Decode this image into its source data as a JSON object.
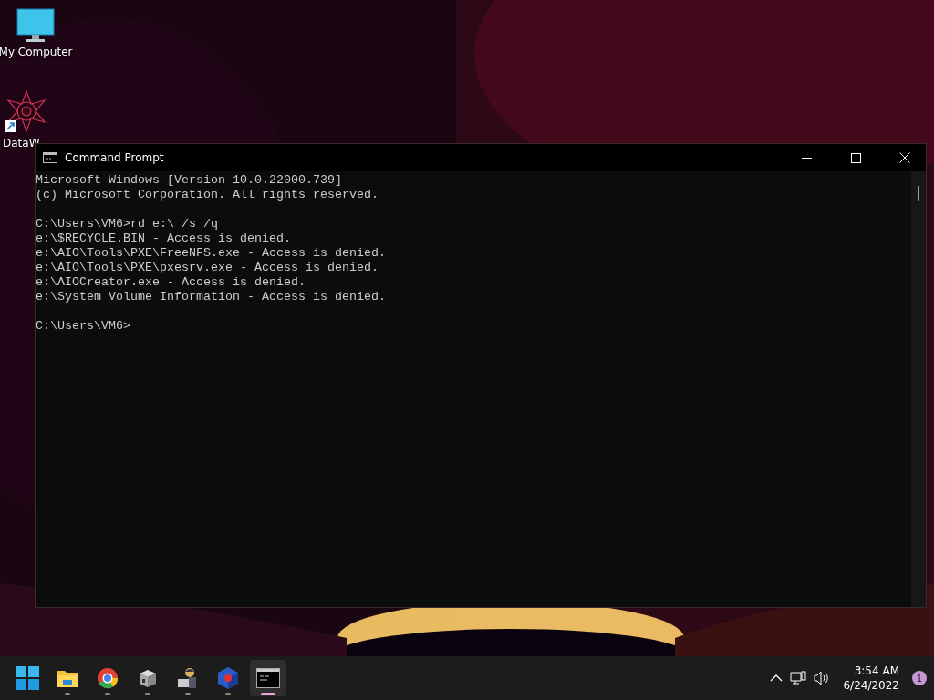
{
  "desktop_icons": [
    {
      "kind": "monitor",
      "label": "My Computer"
    },
    {
      "kind": "shortcut",
      "label": "DataW"
    }
  ],
  "window": {
    "title": "Command Prompt",
    "blocks": [
      [
        "Microsoft Windows [Version 10.0.22000.739]",
        "(c) Microsoft Corporation. All rights reserved."
      ],
      [
        "C:\\Users\\VM6>rd e:\\ /s /q",
        "e:\\$RECYCLE.BIN - Access is denied.",
        "e:\\AIO\\Tools\\PXE\\FreeNFS.exe - Access is denied.",
        "e:\\AIO\\Tools\\PXE\\pxesrv.exe - Access is denied.",
        "e:\\AIOCreator.exe - Access is denied.",
        "e:\\System Volume Information - Access is denied."
      ],
      [
        "C:\\Users\\VM6>"
      ]
    ]
  },
  "taskbar": {
    "apps": [
      {
        "kind": "start",
        "open": false,
        "selected": false
      },
      {
        "kind": "folder",
        "open": true,
        "selected": false
      },
      {
        "kind": "browser",
        "open": true,
        "selected": false
      },
      {
        "kind": "box",
        "open": true,
        "selected": false
      },
      {
        "kind": "figure",
        "open": true,
        "selected": false
      },
      {
        "kind": "cube",
        "open": true,
        "selected": false
      },
      {
        "kind": "terminal",
        "open": true,
        "selected": true
      }
    ],
    "time": "3:54 AM",
    "date": "6/24/2022",
    "notification_count": "1"
  }
}
